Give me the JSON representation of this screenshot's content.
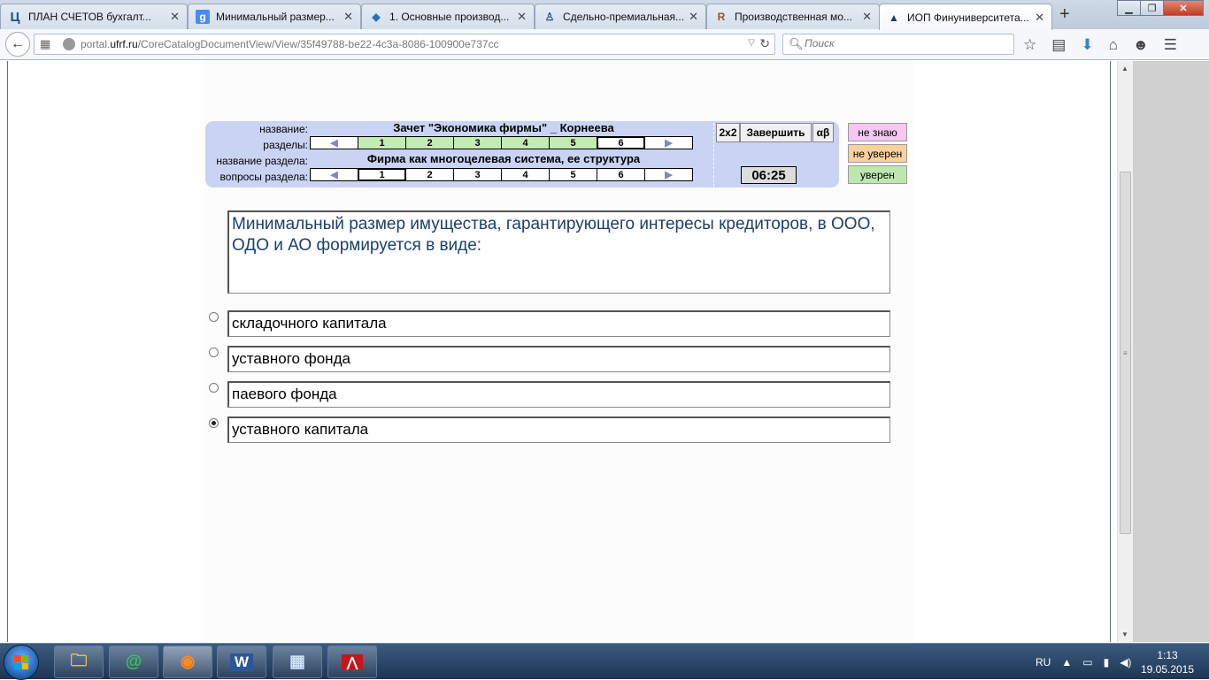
{
  "browser": {
    "tabs": [
      {
        "title": "ПЛАН СЧЕТОВ бухгалт...",
        "favicon": "Ц"
      },
      {
        "title": "Минимальный размер...",
        "favicon": "g"
      },
      {
        "title": "1. Основные производ...",
        "favicon": "◆"
      },
      {
        "title": "Сдельно-премиальная...",
        "favicon": "♙"
      },
      {
        "title": "Производственная мо...",
        "favicon": "R"
      },
      {
        "title": "ИОП Финуниверситета...",
        "favicon": "▲"
      }
    ],
    "new_tab": "+",
    "url_host_prefix": "portal.",
    "url_host": "ufrf.ru",
    "url_path": "/CoreCatalogDocumentView/View/35f49788-be22-4c3a-8086-100900e737cc",
    "search_placeholder": "Поиск"
  },
  "test": {
    "labels": {
      "name": "название:",
      "sections": "разделы:",
      "section_name": "название раздела:",
      "questions": "вопросы раздела:"
    },
    "name": "Зачет \"Экономика фирмы\" _ Корнеева",
    "section_name": "Фирма как многоцелевая система, ее структура",
    "sections": [
      "1",
      "2",
      "3",
      "4",
      "5",
      "6"
    ],
    "questions": [
      "1",
      "2",
      "3",
      "4",
      "5",
      "6"
    ],
    "buttons": {
      "two_by_two": "2x2",
      "finish": "Завершить",
      "alpha_beta": "αβ"
    },
    "timer": "06:25",
    "confidence": {
      "dont_know": "не знаю",
      "not_sure": "не уверен",
      "sure": "уверен"
    },
    "question_text": "Минимальный размер имущества, гарантирующего интересы кредиторов,  в ООО, ОДО  и АО формируется в виде:",
    "answers": [
      {
        "text": "складочного капитала",
        "selected": false
      },
      {
        "text": "уставного фонда",
        "selected": false
      },
      {
        "text": "паевого фонда",
        "selected": false
      },
      {
        "text": "уставного капитала",
        "selected": true
      }
    ]
  },
  "taskbar": {
    "lang": "RU",
    "time": "1:13",
    "date": "19.05.2015"
  },
  "colors": {
    "panel": "#c9d3f3",
    "green_cell": "#c3ecb3",
    "dont_know": "#f7c6f2",
    "not_sure": "#f8d29c",
    "sure": "#bde7b0",
    "question_text": "#1b3f6e"
  }
}
